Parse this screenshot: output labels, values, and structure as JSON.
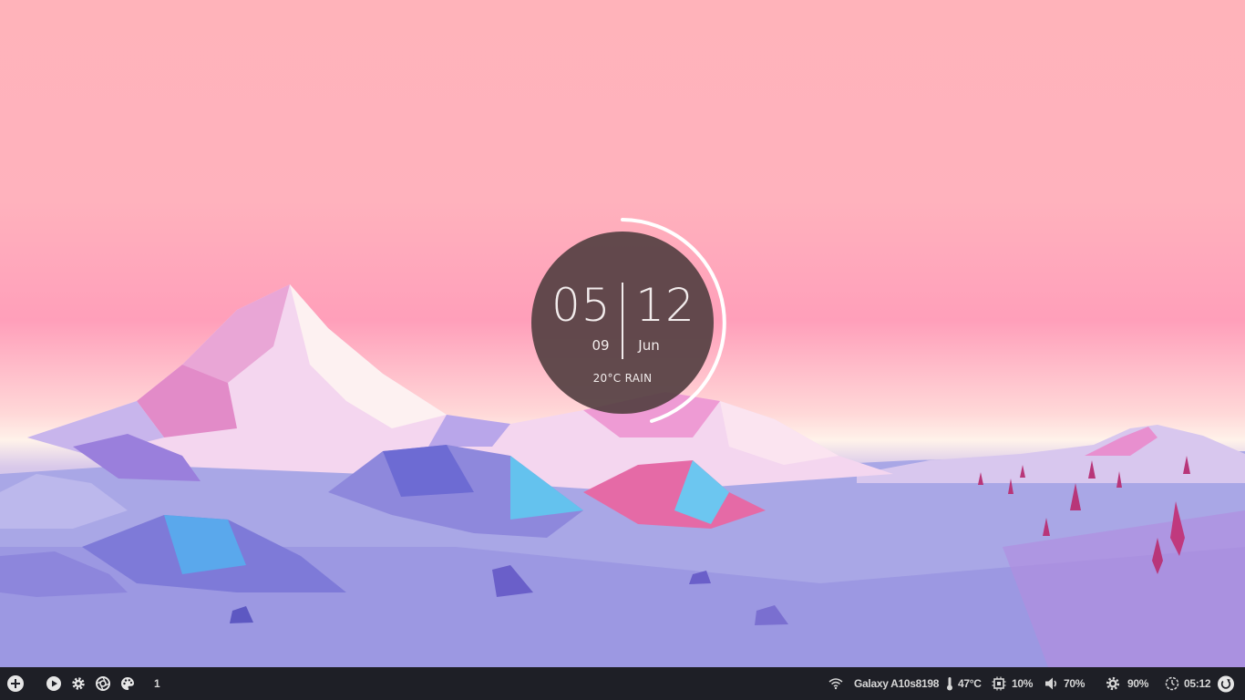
{
  "clock": {
    "hour": "05",
    "minute": "09",
    "day": "12",
    "month": "Jun",
    "weather": "20°C RAIN"
  },
  "taskbar": {
    "left": {
      "launcher_icon": "plus-circle-icon",
      "media_icon": "play-icon",
      "settings_icon": "gear-icon",
      "camera_icon": "aperture-icon",
      "theme_icon": "palette-icon",
      "workspace": "1"
    },
    "right": {
      "wifi_icon": "wifi-icon",
      "network": "Galaxy A10s8198",
      "temperature_icon": "thermometer-icon",
      "temperature": "47°C",
      "cpu_icon": "cpu-icon",
      "cpu": "10%",
      "volume_icon": "speaker-icon",
      "volume": "70%",
      "brightness_icon": "sun-icon",
      "brightness": "90%",
      "clock_icon": "clock-icon",
      "time": "05:12",
      "power_icon": "power-icon"
    }
  },
  "colors": {
    "taskbar_bg": "#1e1f26",
    "taskbar_text": "#d6d6d6",
    "clock_bg": "#554042",
    "clock_text": "#f2ecec"
  }
}
